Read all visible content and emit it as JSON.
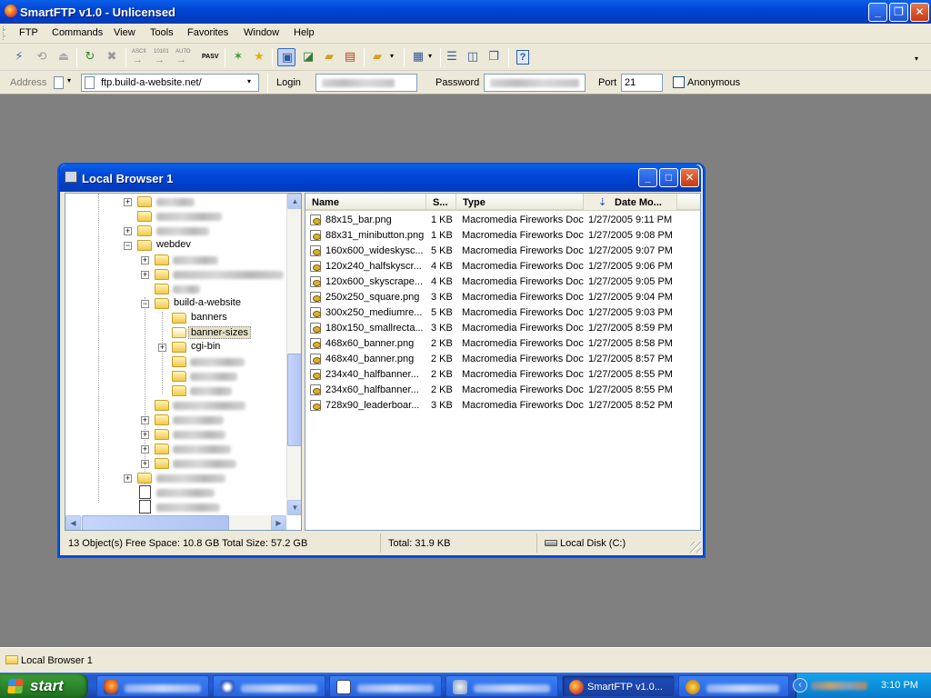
{
  "app": {
    "title": "SmartFTP v1.0 - Unlicensed",
    "window_buttons": [
      "_",
      "❐",
      "✕"
    ]
  },
  "menu": [
    "FTP",
    "Commands",
    "View",
    "Tools",
    "Favorites",
    "Window",
    "Help"
  ],
  "toolbar": {
    "pasv_label": "PASV",
    "ascii_label": "ASCII",
    "binary_label": "10101",
    "auto_label": "AUTO",
    "help_label": "?"
  },
  "address_bar": {
    "address_label": "Address",
    "address_value": "ftp.build-a-website.net/",
    "login_label": "Login",
    "password_label": "Password",
    "port_label": "Port",
    "port_value": "21",
    "anonymous_label": "Anonymous"
  },
  "local_browser": {
    "title": "Local Browser 1",
    "tree": {
      "visible_folders": [
        "webdev",
        "build-a-website",
        "banners",
        "banner-sizes",
        "cgi-bin"
      ],
      "selected": "banner-sizes"
    },
    "columns": [
      "Name",
      "S...",
      "Type",
      "Date Mo..."
    ],
    "sort_indicator": "⇣",
    "files": [
      {
        "name": "88x15_bar.png",
        "size": "1 KB",
        "type": "Macromedia Fireworks Doc",
        "date": "1/27/2005 9:11 PM"
      },
      {
        "name": "88x31_minibutton.png",
        "size": "1 KB",
        "type": "Macromedia Fireworks Doc",
        "date": "1/27/2005 9:08 PM"
      },
      {
        "name": "160x600_wideskysc...",
        "size": "5 KB",
        "type": "Macromedia Fireworks Doc",
        "date": "1/27/2005 9:07 PM"
      },
      {
        "name": "120x240_halfskyscr...",
        "size": "4 KB",
        "type": "Macromedia Fireworks Doc",
        "date": "1/27/2005 9:06 PM"
      },
      {
        "name": "120x600_skyscrape...",
        "size": "4 KB",
        "type": "Macromedia Fireworks Doc",
        "date": "1/27/2005 9:05 PM"
      },
      {
        "name": "250x250_square.png",
        "size": "3 KB",
        "type": "Macromedia Fireworks Doc",
        "date": "1/27/2005 9:04 PM"
      },
      {
        "name": "300x250_mediumre...",
        "size": "5 KB",
        "type": "Macromedia Fireworks Doc",
        "date": "1/27/2005 9:03 PM"
      },
      {
        "name": "180x150_smallrecta...",
        "size": "3 KB",
        "type": "Macromedia Fireworks Doc",
        "date": "1/27/2005 8:59 PM"
      },
      {
        "name": "468x60_banner.png",
        "size": "2 KB",
        "type": "Macromedia Fireworks Doc",
        "date": "1/27/2005 8:58 PM"
      },
      {
        "name": "468x40_banner.png",
        "size": "2 KB",
        "type": "Macromedia Fireworks Doc",
        "date": "1/27/2005 8:57 PM"
      },
      {
        "name": "234x40_halfbanner...",
        "size": "2 KB",
        "type": "Macromedia Fireworks Doc",
        "date": "1/27/2005 8:55 PM"
      },
      {
        "name": "234x60_halfbanner...",
        "size": "2 KB",
        "type": "Macromedia Fireworks Doc",
        "date": "1/27/2005 8:55 PM"
      },
      {
        "name": "728x90_leaderboar...",
        "size": "3 KB",
        "type": "Macromedia Fireworks Doc",
        "date": "1/27/2005 8:52 PM"
      }
    ],
    "status": {
      "objects": "13 Object(s) Free Space: 10.8 GB Total Size: 57.2 GB",
      "total": "Total: 31.9 KB",
      "disk": "Local Disk (C:)"
    }
  },
  "mdi_tab": {
    "label": "Local Browser 1"
  },
  "taskbar": {
    "start_label": "start",
    "active_task": "SmartFTP v1.0...",
    "clock": "3:10 PM"
  }
}
